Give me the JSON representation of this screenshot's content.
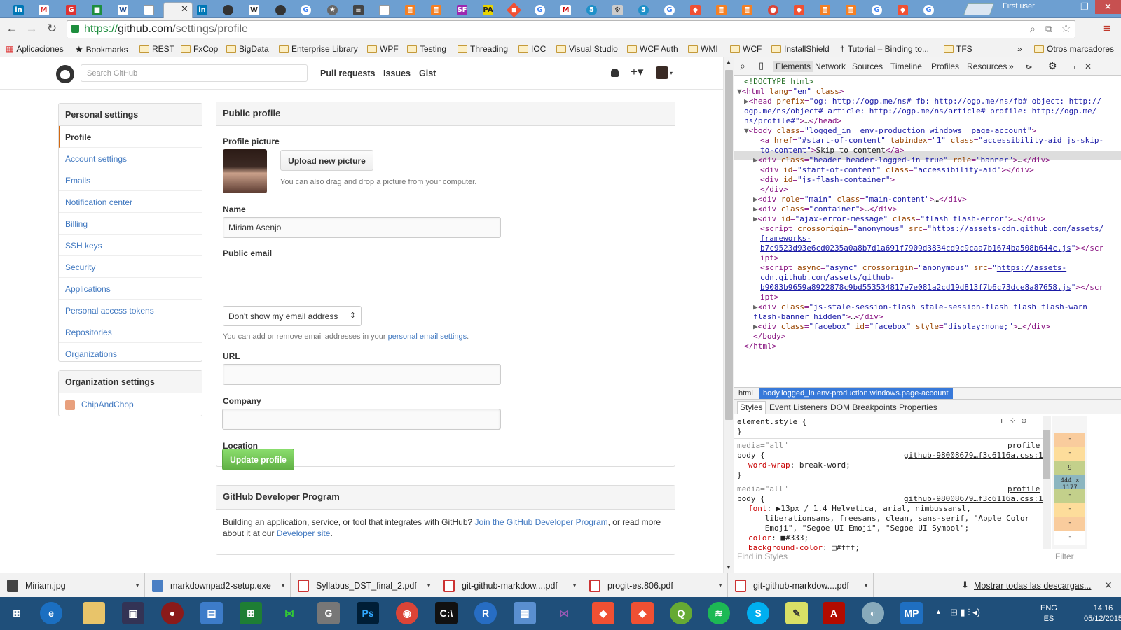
{
  "browser": {
    "user": "First user",
    "url_scheme": "https://",
    "url_host": "github.com",
    "url_path": "/settings/profile",
    "bookmarks": [
      "Aplicaciones",
      "Bookmarks",
      "REST",
      "FxCop",
      "BigData",
      "Enterprise Library",
      "WPF",
      "Testing",
      "Threading",
      "IOC",
      "Visual Studio",
      "WCF Auth",
      "WMI",
      "WCF",
      "InstallShield",
      "Tutorial – Binding to...",
      "TFS"
    ],
    "other_bookmarks": "Otros marcadores",
    "more_bookmarks": "»"
  },
  "github": {
    "search_placeholder": "Search GitHub",
    "nav": [
      "Pull requests",
      "Issues",
      "Gist"
    ],
    "sidebar_title": "Personal settings",
    "sidebar_items": [
      "Profile",
      "Account settings",
      "Emails",
      "Notification center",
      "Billing",
      "SSH keys",
      "Security",
      "Applications",
      "Personal access tokens",
      "Repositories",
      "Organizations"
    ],
    "org_title": "Organization settings",
    "org_name": "ChipAndChop",
    "panel_title": "Public profile",
    "profile_picture_label": "Profile picture",
    "upload_button": "Upload new picture",
    "drag_note": "You can also drag and drop a picture from your computer.",
    "name_label": "Name",
    "name_value": "Miriam Asenjo",
    "email_label": "Public email",
    "email_value": "Don't show my email address",
    "email_note": "You can add or remove email addresses in your ",
    "email_note_link": "personal email settings",
    "email_note_end": ".",
    "url_label": "URL",
    "company_label": "Company",
    "location_label": "Location",
    "update_button": "Update profile",
    "dev_title": "GitHub Developer Program",
    "dev_text_1": "Building an application, service, or tool that integrates with GitHub? ",
    "dev_link_1": "Join the GitHub Developer Program",
    "dev_text_2": ", or read more about it at our ",
    "dev_link_2": "Developer site",
    "dev_text_3": "."
  },
  "devtools": {
    "tabs": [
      "Elements",
      "Network",
      "Sources",
      "Timeline",
      "Profiles",
      "Resources"
    ],
    "more_tabs": "»",
    "crumb_html": "html",
    "crumb_body": "body.logged_in.env-production.windows.page-account",
    "sub_tabs": [
      "Styles",
      "Event Listeners",
      "DOM Breakpoints",
      "Properties"
    ],
    "find_styles": "Find in Styles",
    "filter": "Filter",
    "metrics": [
      "-",
      "-",
      "g",
      "444 × 1177",
      "-",
      "-",
      "-",
      "-"
    ],
    "style_lines": [
      {
        "t": "element.style {",
        "f": ""
      },
      {
        "t": "}",
        "f": ""
      },
      {
        "t": "media=\"all\"",
        "f": "profile"
      },
      {
        "t": "body {",
        "f": "github-98008679…f3c6116a.css:1"
      },
      {
        "p": "word-wrap",
        "v": "break-word;"
      },
      {
        "t": "}",
        "f": ""
      },
      {
        "t": "media=\"all\"",
        "f": "profile"
      },
      {
        "t": "body {",
        "f": "github-98008679…f3c6116a.css:1"
      },
      {
        "p": "font",
        "v": "▶13px / 1.4 Helvetica, arial, nimbussansl,"
      },
      {
        "t": "      liberationsans, freesans, clean, sans-serif, \"Apple Color",
        "f": ""
      },
      {
        "t": "      Emoji\", \"Segoe UI Emoji\", \"Segoe UI Symbol\";",
        "f": ""
      },
      {
        "p": "color",
        "v": "■#333;"
      },
      {
        "p": "background-color",
        "v": "□#fff;"
      }
    ]
  },
  "downloads": {
    "items": [
      "Miriam.jpg",
      "markdownpad2-setup.exe",
      "Syllabus_DST_final_2.pdf",
      "git-github-markdow....pdf",
      "progit-es.806.pdf",
      "git-github-markdow....pdf"
    ],
    "show_all": "Mostrar todas las descargas..."
  },
  "taskbar": {
    "lang": "ENG",
    "region": "ES",
    "time": "14:16",
    "date": "05/12/2015",
    "apps": [
      "ie",
      "explorer",
      "remote",
      "media",
      "chat",
      "excel",
      "vs-code",
      "gimp",
      "photoshop",
      "chrome",
      "cmd",
      "r",
      "manager",
      "visual-studio",
      "git",
      "git-gui",
      "qgis",
      "spotify",
      "skype",
      "notepad",
      "acrobat",
      "paint",
      "markdownpad"
    ]
  },
  "colors": {
    "accent": "#4078c0",
    "success": "#60b044",
    "selected": "#d26911",
    "titlebar": "#6d9fd1"
  }
}
